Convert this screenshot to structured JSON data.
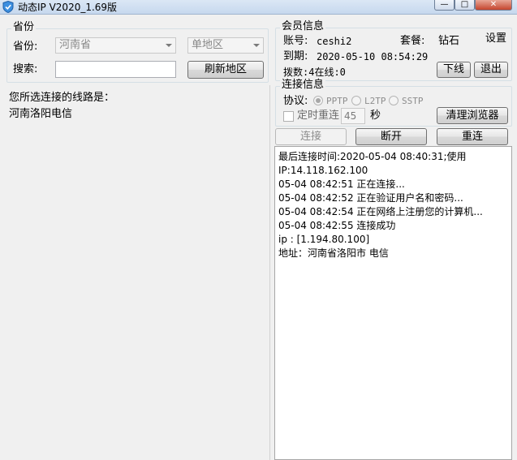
{
  "window": {
    "title": "动态IP V2020_1.69版",
    "minimize": "—",
    "maximize": "□",
    "close": "✕"
  },
  "province_group": {
    "legend": "省份",
    "province_label": "省份:",
    "province_value": "河南省",
    "region_value": "单地区",
    "search_label": "搜索:",
    "search_value": "",
    "refresh_button": "刷新地区"
  },
  "route_panel": {
    "heading": "您所选连接的线路是：",
    "route": "河南洛阳电信"
  },
  "member_group": {
    "legend": "会员信息",
    "settings_link": "设置",
    "account_label": "账号:",
    "account_value": "ceshi2",
    "package_label": "套餐:",
    "package_value": "钻石",
    "expiry_label": "到期:",
    "expiry_value": "2020-05-10 08:54:29",
    "dial_text": "拨数:4在线:0",
    "offline_button": "下线",
    "exit_button": "退出"
  },
  "connection_group": {
    "legend": "连接信息",
    "protocol_label": "协议:",
    "protocols": [
      "PPTP",
      "L2TP",
      "SSTP"
    ],
    "timed_reconnect_label": "定时重连",
    "timed_value": "45",
    "seconds_label": "秒",
    "clean_browser_button": "清理浏览器"
  },
  "actions": {
    "connect": "连接",
    "disconnect": "断开",
    "reconnect": "重连"
  },
  "log": [
    "最后连接时间:2020-05-04 08:40:31;使用",
    "IP:14.118.162.100",
    "05-04 08:42:51  正在连接...",
    "05-04 08:42:52  正在验证用户名和密码...",
    "05-04 08:42:54  正在网络上注册您的计算机...",
    "05-04 08:42:55  连接成功",
    "ip : [1.194.80.100]",
    "地址：河南省洛阳市 电信"
  ],
  "colors": {
    "titlebar": "#c6d8ee",
    "window_bg": "#f0f0f0",
    "close_button": "#c5452e"
  }
}
